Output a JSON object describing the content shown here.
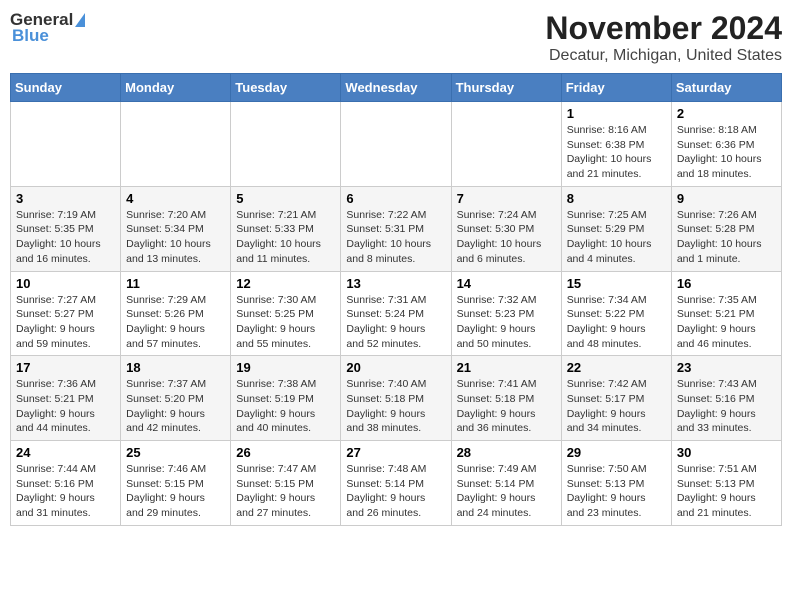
{
  "header": {
    "logo_line1": "General",
    "logo_line2": "Blue",
    "title": "November 2024",
    "subtitle": "Decatur, Michigan, United States"
  },
  "weekdays": [
    "Sunday",
    "Monday",
    "Tuesday",
    "Wednesday",
    "Thursday",
    "Friday",
    "Saturday"
  ],
  "weeks": [
    [
      {
        "day": "",
        "info": ""
      },
      {
        "day": "",
        "info": ""
      },
      {
        "day": "",
        "info": ""
      },
      {
        "day": "",
        "info": ""
      },
      {
        "day": "",
        "info": ""
      },
      {
        "day": "1",
        "info": "Sunrise: 8:16 AM\nSunset: 6:38 PM\nDaylight: 10 hours and 21 minutes."
      },
      {
        "day": "2",
        "info": "Sunrise: 8:18 AM\nSunset: 6:36 PM\nDaylight: 10 hours and 18 minutes."
      }
    ],
    [
      {
        "day": "3",
        "info": "Sunrise: 7:19 AM\nSunset: 5:35 PM\nDaylight: 10 hours and 16 minutes."
      },
      {
        "day": "4",
        "info": "Sunrise: 7:20 AM\nSunset: 5:34 PM\nDaylight: 10 hours and 13 minutes."
      },
      {
        "day": "5",
        "info": "Sunrise: 7:21 AM\nSunset: 5:33 PM\nDaylight: 10 hours and 11 minutes."
      },
      {
        "day": "6",
        "info": "Sunrise: 7:22 AM\nSunset: 5:31 PM\nDaylight: 10 hours and 8 minutes."
      },
      {
        "day": "7",
        "info": "Sunrise: 7:24 AM\nSunset: 5:30 PM\nDaylight: 10 hours and 6 minutes."
      },
      {
        "day": "8",
        "info": "Sunrise: 7:25 AM\nSunset: 5:29 PM\nDaylight: 10 hours and 4 minutes."
      },
      {
        "day": "9",
        "info": "Sunrise: 7:26 AM\nSunset: 5:28 PM\nDaylight: 10 hours and 1 minute."
      }
    ],
    [
      {
        "day": "10",
        "info": "Sunrise: 7:27 AM\nSunset: 5:27 PM\nDaylight: 9 hours and 59 minutes."
      },
      {
        "day": "11",
        "info": "Sunrise: 7:29 AM\nSunset: 5:26 PM\nDaylight: 9 hours and 57 minutes."
      },
      {
        "day": "12",
        "info": "Sunrise: 7:30 AM\nSunset: 5:25 PM\nDaylight: 9 hours and 55 minutes."
      },
      {
        "day": "13",
        "info": "Sunrise: 7:31 AM\nSunset: 5:24 PM\nDaylight: 9 hours and 52 minutes."
      },
      {
        "day": "14",
        "info": "Sunrise: 7:32 AM\nSunset: 5:23 PM\nDaylight: 9 hours and 50 minutes."
      },
      {
        "day": "15",
        "info": "Sunrise: 7:34 AM\nSunset: 5:22 PM\nDaylight: 9 hours and 48 minutes."
      },
      {
        "day": "16",
        "info": "Sunrise: 7:35 AM\nSunset: 5:21 PM\nDaylight: 9 hours and 46 minutes."
      }
    ],
    [
      {
        "day": "17",
        "info": "Sunrise: 7:36 AM\nSunset: 5:21 PM\nDaylight: 9 hours and 44 minutes."
      },
      {
        "day": "18",
        "info": "Sunrise: 7:37 AM\nSunset: 5:20 PM\nDaylight: 9 hours and 42 minutes."
      },
      {
        "day": "19",
        "info": "Sunrise: 7:38 AM\nSunset: 5:19 PM\nDaylight: 9 hours and 40 minutes."
      },
      {
        "day": "20",
        "info": "Sunrise: 7:40 AM\nSunset: 5:18 PM\nDaylight: 9 hours and 38 minutes."
      },
      {
        "day": "21",
        "info": "Sunrise: 7:41 AM\nSunset: 5:18 PM\nDaylight: 9 hours and 36 minutes."
      },
      {
        "day": "22",
        "info": "Sunrise: 7:42 AM\nSunset: 5:17 PM\nDaylight: 9 hours and 34 minutes."
      },
      {
        "day": "23",
        "info": "Sunrise: 7:43 AM\nSunset: 5:16 PM\nDaylight: 9 hours and 33 minutes."
      }
    ],
    [
      {
        "day": "24",
        "info": "Sunrise: 7:44 AM\nSunset: 5:16 PM\nDaylight: 9 hours and 31 minutes."
      },
      {
        "day": "25",
        "info": "Sunrise: 7:46 AM\nSunset: 5:15 PM\nDaylight: 9 hours and 29 minutes."
      },
      {
        "day": "26",
        "info": "Sunrise: 7:47 AM\nSunset: 5:15 PM\nDaylight: 9 hours and 27 minutes."
      },
      {
        "day": "27",
        "info": "Sunrise: 7:48 AM\nSunset: 5:14 PM\nDaylight: 9 hours and 26 minutes."
      },
      {
        "day": "28",
        "info": "Sunrise: 7:49 AM\nSunset: 5:14 PM\nDaylight: 9 hours and 24 minutes."
      },
      {
        "day": "29",
        "info": "Sunrise: 7:50 AM\nSunset: 5:13 PM\nDaylight: 9 hours and 23 minutes."
      },
      {
        "day": "30",
        "info": "Sunrise: 7:51 AM\nSunset: 5:13 PM\nDaylight: 9 hours and 21 minutes."
      }
    ]
  ]
}
